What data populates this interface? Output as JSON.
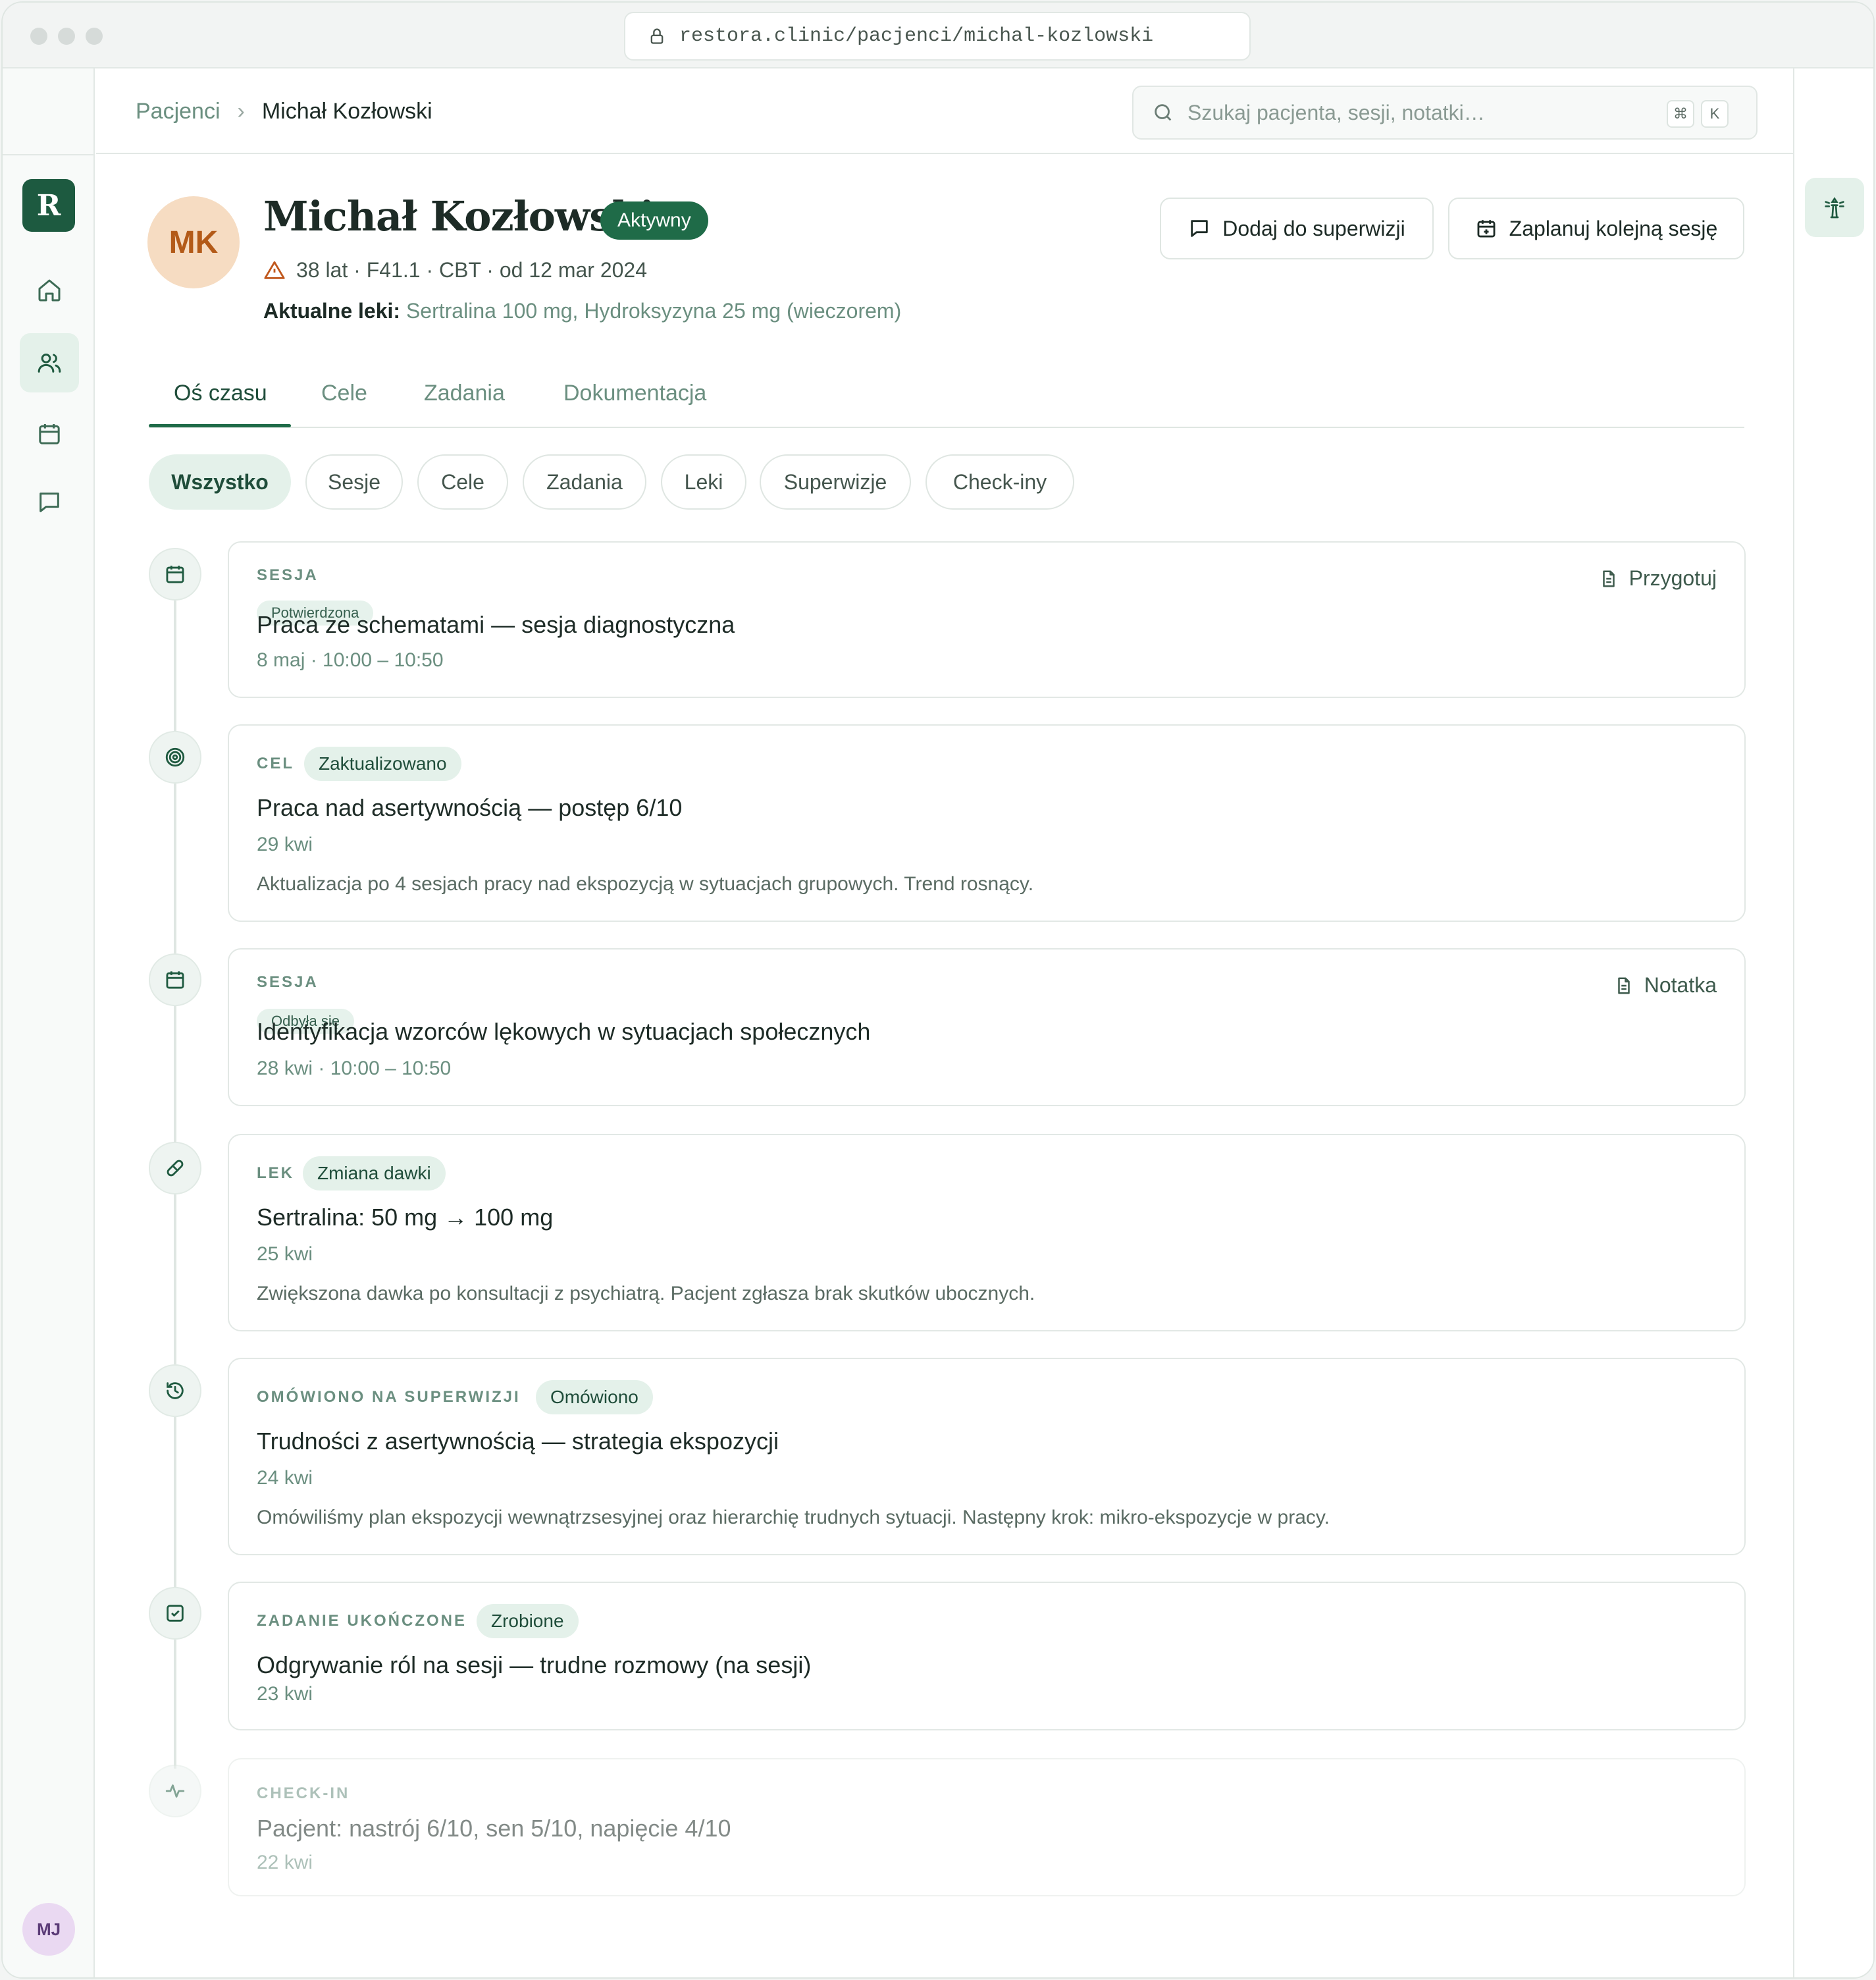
{
  "browser": {
    "url": "restora.clinic/pacjenci/michal-kozlowski"
  },
  "sidebar": {
    "logo": "R",
    "items": [
      {
        "icon": "home-icon"
      },
      {
        "icon": "users-icon",
        "active": true
      },
      {
        "icon": "calendar-icon"
      },
      {
        "icon": "message-icon"
      }
    ],
    "user_initials": "MJ"
  },
  "breadcrumb": {
    "parent": "Pacjenci",
    "separator": "›",
    "current": "Michał Kozłowski"
  },
  "search": {
    "placeholder": "Szukaj pacjenta, sesji, notatki…",
    "kbd1": "⌘",
    "kbd2": "K"
  },
  "patient": {
    "initials": "MK",
    "name": "Michał Kozłowski",
    "status": "Aktywny",
    "meta": "38 lat · F41.1 · CBT · od 12 mar 2024",
    "meds_label": "Aktualne leki:",
    "meds_value": "Sertralina 100 mg, Hydroksyzyna 25 mg (wieczorem)"
  },
  "actions": {
    "supervision": "Dodaj do superwizji",
    "schedule": "Zaplanuj kolejną sesję"
  },
  "tabs": [
    {
      "label": "Oś czasu",
      "active": true
    },
    {
      "label": "Cele"
    },
    {
      "label": "Zadania"
    },
    {
      "label": "Dokumentacja"
    }
  ],
  "filters": [
    {
      "label": "Wszystko",
      "active": true
    },
    {
      "label": "Sesje"
    },
    {
      "label": "Cele"
    },
    {
      "label": "Zadania"
    },
    {
      "label": "Leki"
    },
    {
      "label": "Superwizje"
    },
    {
      "label": "Check-iny"
    }
  ],
  "timeline": [
    {
      "kind": "SESJA",
      "tag": "Potwierdzona",
      "title": "Praca ze schematami — sesja diagnostyczna",
      "date": "8 maj · 10:00 – 10:50",
      "action": "Przygotuj",
      "icon": "calendar-icon"
    },
    {
      "kind": "CEL",
      "tag": "Zaktualizowano",
      "title": "Praca nad asertywnością — postęp 6/10",
      "date": "29 kwi",
      "desc": "Aktualizacja po 4 sesjach pracy nad ekspozycją w sytuacjach grupowych. Trend rosnący.",
      "icon": "target-icon"
    },
    {
      "kind": "SESJA",
      "tag": "Odbyła się",
      "title": "Identyfikacja wzorców lękowych w sytuacjach społecznych",
      "date": "28 kwi · 10:00 – 10:50",
      "action": "Notatka",
      "icon": "calendar-icon"
    },
    {
      "kind": "LEK",
      "tag": "Zmiana dawki",
      "title": "Sertralina: 50 mg → 100 mg",
      "date": "25 kwi",
      "desc": "Zwiększona dawka po konsultacji z psychiatrą. Pacjent zgłasza brak skutków ubocznych.",
      "icon": "pill-icon"
    },
    {
      "kind": "OMÓWIONO NA SUPERWIZJI",
      "tag": "Omówiono",
      "title": "Trudności z asertywnością — strategia ekspozycji",
      "date": "24 kwi",
      "desc": "Omówiliśmy plan ekspozycji wewnątrzsesyjnej oraz hierarchię trudnych sytuacji. Następny krok: mikro-ekspozycje w pracy.",
      "icon": "history-icon"
    },
    {
      "kind": "ZADANIE UKOŃCZONE",
      "tag": "Zrobione",
      "title": "Odgrywanie ról na sesji — trudne rozmowy (na sesji)",
      "date": "23 kwi",
      "icon": "check-square-icon"
    },
    {
      "kind": "CHECK-IN",
      "title": "Pacjent: nastrój 6/10, sen 5/10, napięcie 4/10",
      "date": "22 kwi",
      "icon": "activity-icon"
    }
  ],
  "colors": {
    "brand": "#1d5a40",
    "accent_bg": "#e4f1ea",
    "muted_text": "#6b8f80",
    "avatar_bg": "#f6dcc2"
  }
}
